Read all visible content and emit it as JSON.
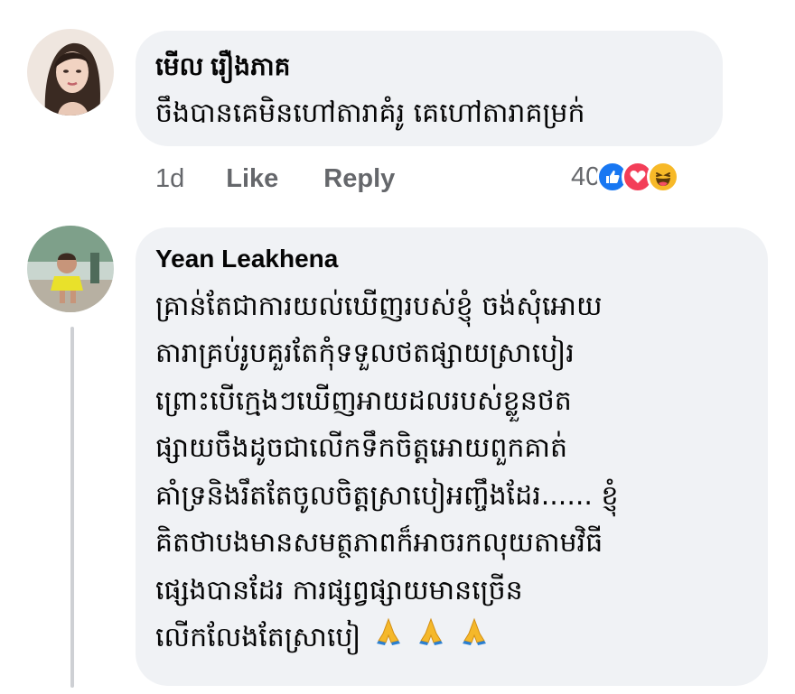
{
  "comments": [
    {
      "author": "មើល រឿងភាគ",
      "lines": [
        "ចឹងបានគេមិនហៅតារាគំរូ គេហៅតារាគម្រក់"
      ],
      "timestamp": "1d",
      "like_label": "Like",
      "reply_label": "Reply",
      "reaction_count": "40",
      "reactions": [
        "like-icon",
        "love-icon",
        "haha-icon"
      ],
      "colors": {
        "like": "#1877f2",
        "love": "#f33e58",
        "haha": "#f7b928"
      }
    },
    {
      "author": "Yean Leakhena",
      "lines": [
        "គ្រាន់តែជាការយល់ឃើញរបស់ខ្ញុំ ចង់សុំអោយ",
        "តារាគ្រប់រូបគួរតែកុំទទួលថតផ្សាយស្រាបៀរ",
        "ព្រោះបើក្មេងៗឃើញអាយដលរបស់ខ្លួនថត",
        "ផ្សាយចឹងដូចជាលើកទឹកចិត្តអោយពួកគាត់",
        "គាំទ្រនិងរឹតតែចូលចិត្តស្រាបៀអញ្ចឹងដែរ...... ខ្ញុំ",
        "គិតថាបងមានសមត្ថភាពក៏អាចរកលុយតាមវិធី",
        "ផ្សេងបានដែរ ការផ្សព្វផ្សាយមានច្រើន",
        "លើកលែងតែស្រាបៀ"
      ],
      "trailing_emoji": [
        "folded-hands-icon",
        "folded-hands-icon",
        "folded-hands-icon"
      ]
    }
  ],
  "colors": {
    "bubble": "#f0f2f5",
    "meta_text": "#65676b",
    "thread_line": "#ced0d4"
  }
}
